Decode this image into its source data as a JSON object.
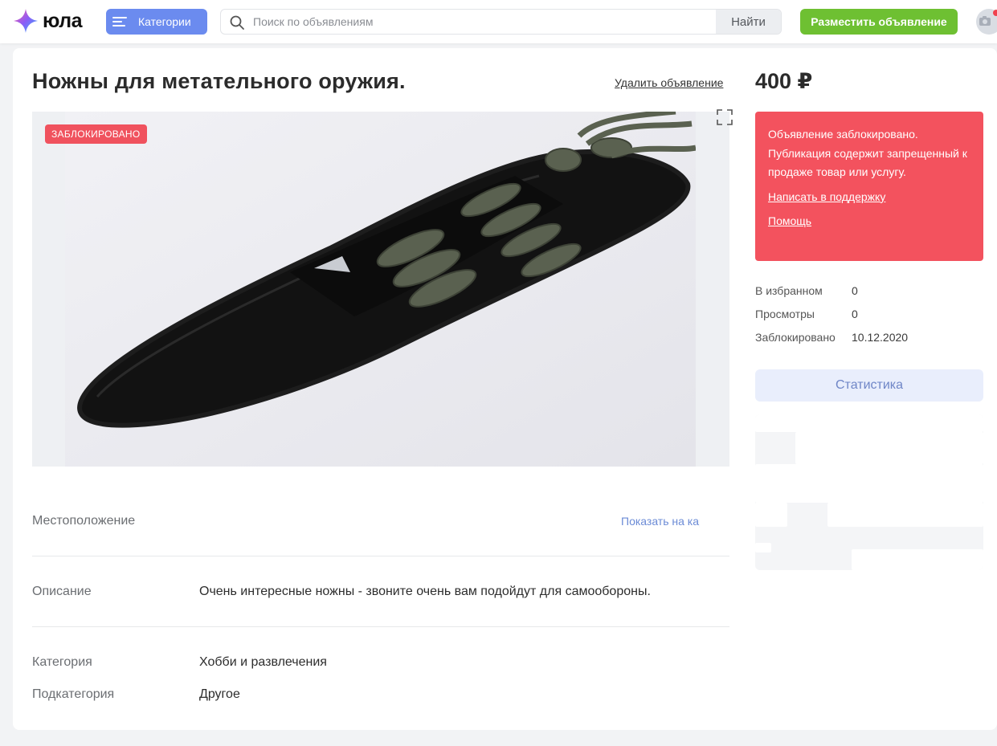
{
  "header": {
    "logo_text": "юла",
    "categories_label": "Категории",
    "search_placeholder": "Поиск по объявлениям",
    "search_button": "Найти",
    "post_button": "Разместить объявление"
  },
  "listing": {
    "title": "Ножны для метательного оружия.",
    "delete_link": "Удалить объявление",
    "price": "400 ₽",
    "status_badge": "ЗАБЛОКИРОВАНО"
  },
  "blocked_notice": {
    "message": "Объявление заблокировано. Публикация содержит запрещенный к продаже товар или услугу.",
    "support_link": "Написать в поддержку",
    "help_link": "Помощь"
  },
  "stats": [
    {
      "label": "В избранном",
      "value": "0"
    },
    {
      "label": "Просмотры",
      "value": "0"
    },
    {
      "label": "Заблокировано",
      "value": "10.12.2020"
    }
  ],
  "statistics_button": "Статистика",
  "details": {
    "location_label": "Местоположение",
    "show_on_map": "Показать на карте",
    "description_label": "Описание",
    "description": "Очень интересные ножны - звоните очень вам подойдут для самообороны.",
    "category_label": "Категория",
    "category": "Хобби и развлечения",
    "subcategory_label": "Подкатегория",
    "subcategory": "Другое"
  },
  "colors": {
    "accent_blue": "#6b8bef",
    "post_green": "#6ec032",
    "blocked_red": "#f3525e"
  }
}
